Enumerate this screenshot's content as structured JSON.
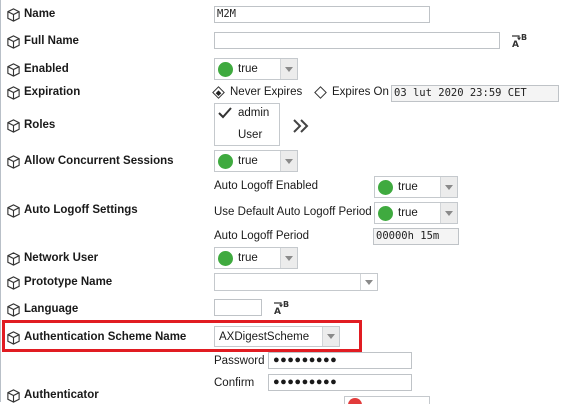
{
  "properties": {
    "name": {
      "label": "Name",
      "value": "M2M"
    },
    "full_name": {
      "label": "Full Name",
      "value": ""
    },
    "enabled": {
      "label": "Enabled",
      "value": "true"
    },
    "expiration": {
      "label": "Expiration",
      "never_expires": "Never Expires",
      "expires_on": "Expires On",
      "expires_value": "03 lut 2020 23:59 CET",
      "selected": "Never Expires"
    },
    "roles": {
      "label": "Roles",
      "items": [
        "admin",
        "User"
      ],
      "checked": "admin"
    },
    "allow_concurrent": {
      "label": "Allow Concurrent Sessions",
      "value": "true"
    },
    "auto_logoff": {
      "label": "Auto Logoff Settings",
      "enabled_label": "Auto Logoff Enabled",
      "enabled_value": "true",
      "default_period_label": "Use Default Auto Logoff Period",
      "default_period_value": "true",
      "period_label": "Auto Logoff Period",
      "period_value": "00000h 15m"
    },
    "network_user": {
      "label": "Network User",
      "value": "true"
    },
    "prototype_name": {
      "label": "Prototype Name",
      "value": ""
    },
    "language": {
      "label": "Language",
      "value": ""
    },
    "auth_scheme": {
      "label": "Authentication Scheme Name",
      "value": "AXDigestScheme"
    },
    "authenticator": {
      "label": "Authenticator",
      "password_label": "Password",
      "password_value": "●●●●●●●●●",
      "confirm_label": "Confirm",
      "confirm_value": "●●●●●●●●●"
    }
  },
  "colors": {
    "status_true": "#3faa3f",
    "highlight": "#e11c22"
  },
  "icons": [
    "property-cube-icon",
    "text-format-icon",
    "double-chevron-right-icon",
    "checkmark-icon"
  ]
}
